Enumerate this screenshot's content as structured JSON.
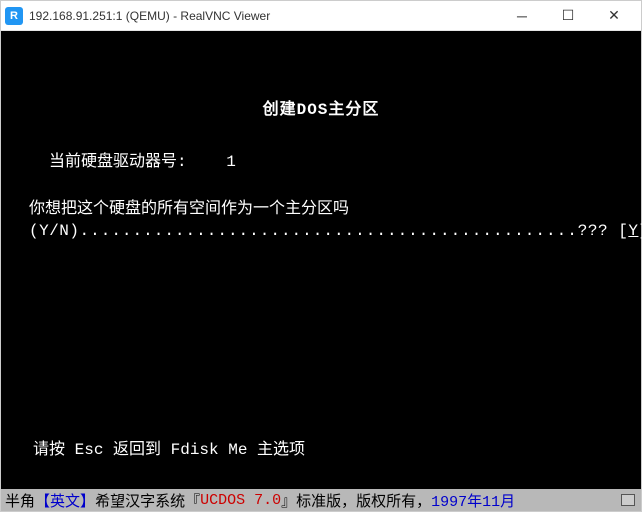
{
  "window": {
    "title": "192.168.91.251:1 (QEMU) - RealVNC Viewer"
  },
  "terminal": {
    "heading": "创建DOS主分区",
    "drive_label": "当前硬盘驱动器号:",
    "drive_number": "1",
    "question": "你想把这个硬盘的所有空间作为一个主分区吗",
    "yn_label": "(Y/N)",
    "dots": "...............................................",
    "prompt_suffix": "???",
    "bracket_open": "[",
    "input_value": "Y",
    "bracket_close": "]",
    "footer_prefix": "请按 ",
    "footer_key": "Esc",
    "footer_suffix": " 返回到 Fdisk Me 主选项"
  },
  "statusbar": {
    "half_width": "半角",
    "lang_open": "【",
    "lang": "英文",
    "lang_close": "】",
    "spacer": "   ",
    "sys_prefix": "希望汉字系统『",
    "sys_name": "UCDOS 7.0",
    "sys_suffix": "』标准版，版权所有，",
    "year": "1997年11月"
  }
}
